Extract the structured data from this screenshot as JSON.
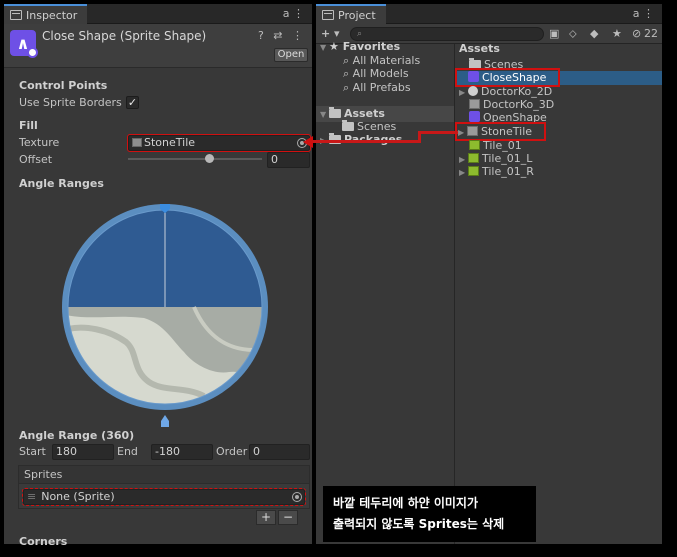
{
  "inspector": {
    "tab_label": "Inspector",
    "tab_controls": "a ⋮",
    "title": "Close Shape (Sprite Shape)",
    "header_icons": "? ⇄ ⋮",
    "open_button": "Open",
    "control_points_label": "Control Points",
    "use_sprite_borders_label": "Use Sprite Borders",
    "use_sprite_borders_checked": "✓",
    "fill_label": "Fill",
    "texture_label": "Texture",
    "texture_value": "StoneTile",
    "offset_label": "Offset",
    "offset_value": "0",
    "offset_slider_fraction": 0.5,
    "angle_ranges_label": "Angle Ranges",
    "angle_range_title": "Angle Range (360)",
    "start_label": "Start",
    "start_value": "180",
    "end_label": "End",
    "end_value": "-180",
    "order_label": "Order",
    "order_value": "0",
    "sprites_label": "Sprites",
    "sprites_value": "None (Sprite)",
    "add_button": "+",
    "remove_button": "−",
    "corners_label": "Corners"
  },
  "project": {
    "tab_label": "Project",
    "tab_controls": "a ⋮",
    "add_button": "+ ▾",
    "search_placeholder": "",
    "hidden_count": "22",
    "favorites_label": "Favorites",
    "favorites": [
      "All Materials",
      "All Models",
      "All Prefabs"
    ],
    "assets_tree_label": "Assets",
    "assets_tree_children": [
      "Scenes",
      "Packages"
    ],
    "assets_header": "Assets",
    "assets": [
      {
        "name": "Scenes",
        "icon": "folder-icon"
      },
      {
        "name": "CloseShape",
        "icon": "sprite-shape-icon"
      },
      {
        "name": "DoctorKo_2D",
        "icon": "scene-icon"
      },
      {
        "name": "DoctorKo_3D",
        "icon": "scene-icon"
      },
      {
        "name": "OpenShape",
        "icon": "sprite-shape-icon"
      },
      {
        "name": "StoneTile",
        "icon": "texture-icon"
      },
      {
        "name": "Tile_01",
        "icon": "tile-icon"
      },
      {
        "name": "Tile_01_L",
        "icon": "tile-icon"
      },
      {
        "name": "Tile_01_R",
        "icon": "tile-icon"
      }
    ]
  },
  "caption": {
    "line1": "바깥 테두리에 하얀 이미지가",
    "line2": "출력되지 않도록 Sprites는 삭제"
  },
  "colors": {
    "accent_selection": "#2c5d87",
    "annotation_red": "#d01010",
    "range_blue": "#2f5b92",
    "ring_blue": "#5b8ec0"
  }
}
